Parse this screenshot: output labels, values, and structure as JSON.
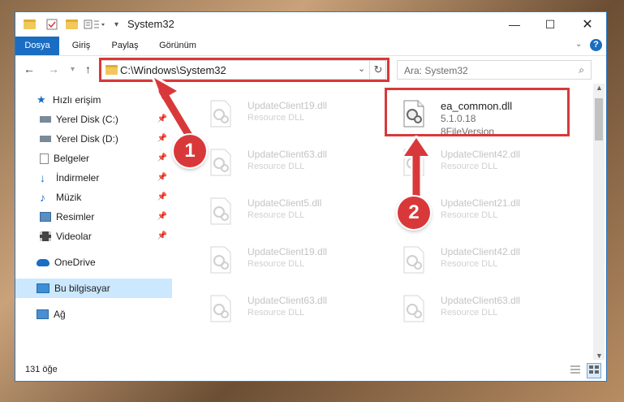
{
  "window": {
    "title": "System32"
  },
  "ribbon": {
    "tabs": [
      {
        "label": "Dosya"
      },
      {
        "label": "Giriş"
      },
      {
        "label": "Paylaş"
      },
      {
        "label": "Görünüm"
      }
    ]
  },
  "address": {
    "path": "C:\\Windows\\System32"
  },
  "search": {
    "placeholder": "Ara: System32"
  },
  "sidebar": {
    "items": [
      {
        "label": "Hızlı erişim"
      },
      {
        "label": "Yerel Disk (C:)"
      },
      {
        "label": "Yerel Disk (D:)"
      },
      {
        "label": "Belgeler"
      },
      {
        "label": "İndirmeler"
      },
      {
        "label": "Müzik"
      },
      {
        "label": "Resimler"
      },
      {
        "label": "Videolar"
      },
      {
        "label": "OneDrive"
      },
      {
        "label": "Bu bilgisayar"
      },
      {
        "label": "Ağ"
      }
    ]
  },
  "files": [
    {
      "name": "UpdateClient19.dll",
      "type": "Resource DLL"
    },
    {
      "name": "ea_common.dll",
      "type": "5.1.0.18",
      "version": "8FileVersion"
    },
    {
      "name": "UpdateClient63.dll",
      "type": "Resource DLL"
    },
    {
      "name": "UpdateClient42.dll",
      "type": "Resource DLL"
    },
    {
      "name": "UpdateClient5.dll",
      "type": "Resource DLL"
    },
    {
      "name": "UpdateClient21.dll",
      "type": "Resource DLL"
    },
    {
      "name": "UpdateClient19.dll",
      "type": "Resource DLL"
    },
    {
      "name": "UpdateClient42.dll",
      "type": "Resource DLL"
    },
    {
      "name": "UpdateClient63.dll",
      "type": "Resource DLL"
    },
    {
      "name": "UpdateClient63.dll",
      "type": "Resource DLL"
    }
  ],
  "status": {
    "count": "131 öğe"
  },
  "annotations": {
    "step1": "1",
    "step2": "2"
  },
  "colors": {
    "accent": "#1a6dc2",
    "highlight": "#d9383a",
    "selected": "#cce8ff"
  }
}
